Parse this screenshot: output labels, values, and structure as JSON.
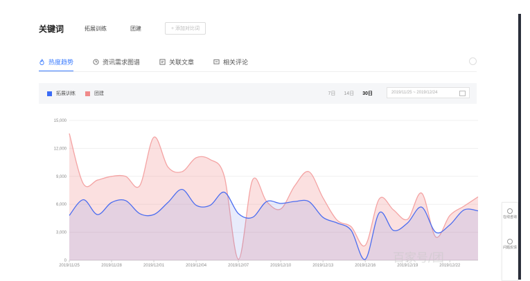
{
  "keyword_bar": {
    "title": "关键词",
    "chips": [
      "拓展训练",
      "团建"
    ],
    "add_placeholder": "+ 添加对比词"
  },
  "tabs": [
    {
      "label": "热度趋势",
      "icon": "flame-icon",
      "active": true
    },
    {
      "label": "资讯需求图谱",
      "icon": "clock-icon",
      "active": false
    },
    {
      "label": "关联文章",
      "icon": "article-icon",
      "active": false
    },
    {
      "label": "相关评论",
      "icon": "comment-icon",
      "active": false
    }
  ],
  "controls": {
    "legend": [
      {
        "label": "拓展训练",
        "color": "#3b6cf6"
      },
      {
        "label": "团建",
        "color": "#f08a8a"
      }
    ],
    "ranges": [
      "7日",
      "14日",
      "30日"
    ],
    "selected_range": "30日",
    "date_range": "2019/11/25 ~ 2019/12/24"
  },
  "chart_data": {
    "type": "area",
    "x": [
      "2019/11/25",
      "2019/11/26",
      "2019/11/27",
      "2019/11/28",
      "2019/11/29",
      "2019/11/30",
      "2019/12/01",
      "2019/12/02",
      "2019/12/03",
      "2019/12/04",
      "2019/12/05",
      "2019/12/06",
      "2019/12/07",
      "2019/12/08",
      "2019/12/09",
      "2019/12/10",
      "2019/12/11",
      "2019/12/12",
      "2019/12/13",
      "2019/12/14",
      "2019/12/15",
      "2019/12/16",
      "2019/12/17",
      "2019/12/18",
      "2019/12/19",
      "2019/12/20",
      "2019/12/21",
      "2019/12/22",
      "2019/12/23",
      "2019/12/24"
    ],
    "x_tick_labels": [
      "2019/11/25",
      "2019/11/28",
      "2019/12/01",
      "2019/12/04",
      "2019/12/07",
      "2019/12/10",
      "2019/12/13",
      "2019/12/16",
      "2019/12/19",
      "2019/12/22"
    ],
    "y_ticks": [
      "0",
      "3,000",
      "6,000",
      "9,000",
      "12,000",
      "15,000"
    ],
    "ylim": [
      0,
      15000
    ],
    "series": [
      {
        "name": "拓展训练",
        "color": "#4a6cf0",
        "fill": "rgba(110,130,230,0.16)",
        "values": [
          4800,
          6500,
          4900,
          6200,
          6400,
          5000,
          4900,
          6200,
          7600,
          5900,
          5900,
          7300,
          5000,
          4600,
          6300,
          6100,
          6300,
          6300,
          4600,
          4000,
          3200,
          100,
          5100,
          3200,
          4000,
          5700,
          3000,
          3800,
          5400,
          5300
        ]
      },
      {
        "name": "团建",
        "color": "#f4a3a3",
        "fill": "rgba(244,160,160,0.32)",
        "values": [
          13600,
          8200,
          8600,
          9000,
          9000,
          8000,
          13200,
          10000,
          9500,
          11000,
          10800,
          9000,
          100,
          8600,
          6300,
          5500,
          8000,
          9500,
          6700,
          4300,
          3600,
          1600,
          6600,
          5400,
          4400,
          7200,
          2500,
          4800,
          5800,
          6800
        ]
      }
    ]
  },
  "watermark": "百家号/团",
  "side_panel": {
    "items": [
      {
        "label": "在线咨询",
        "icon": "chat-icon"
      },
      {
        "label": "问题反馈",
        "icon": "feedback-icon"
      }
    ]
  }
}
